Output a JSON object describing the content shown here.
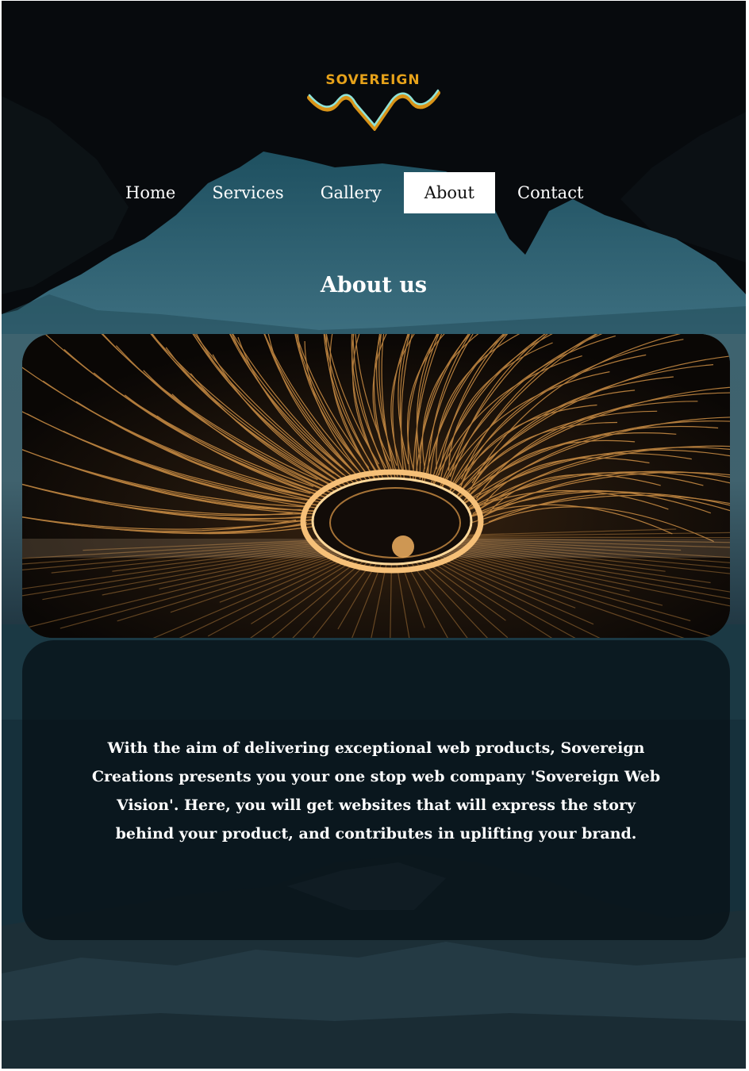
{
  "brand": {
    "name": "SOVEREIGN",
    "accent": "#e6a21a",
    "wave_color": "#8fe3d9"
  },
  "nav": {
    "items": [
      {
        "label": "Home",
        "active": false
      },
      {
        "label": "Services",
        "active": false
      },
      {
        "label": "Gallery",
        "active": false
      },
      {
        "label": "About",
        "active": true
      },
      {
        "label": "Contact",
        "active": false
      }
    ]
  },
  "about": {
    "heading": "About us",
    "image_icon": "steel-wool-fire-spin-photo",
    "body": "With the aim of delivering exceptional web products, Sovereign Creations presents you your one stop web company 'Sovereign Web Vision'. Here, you will get websites that will express the story behind your product, and contributes in uplifting your brand."
  }
}
